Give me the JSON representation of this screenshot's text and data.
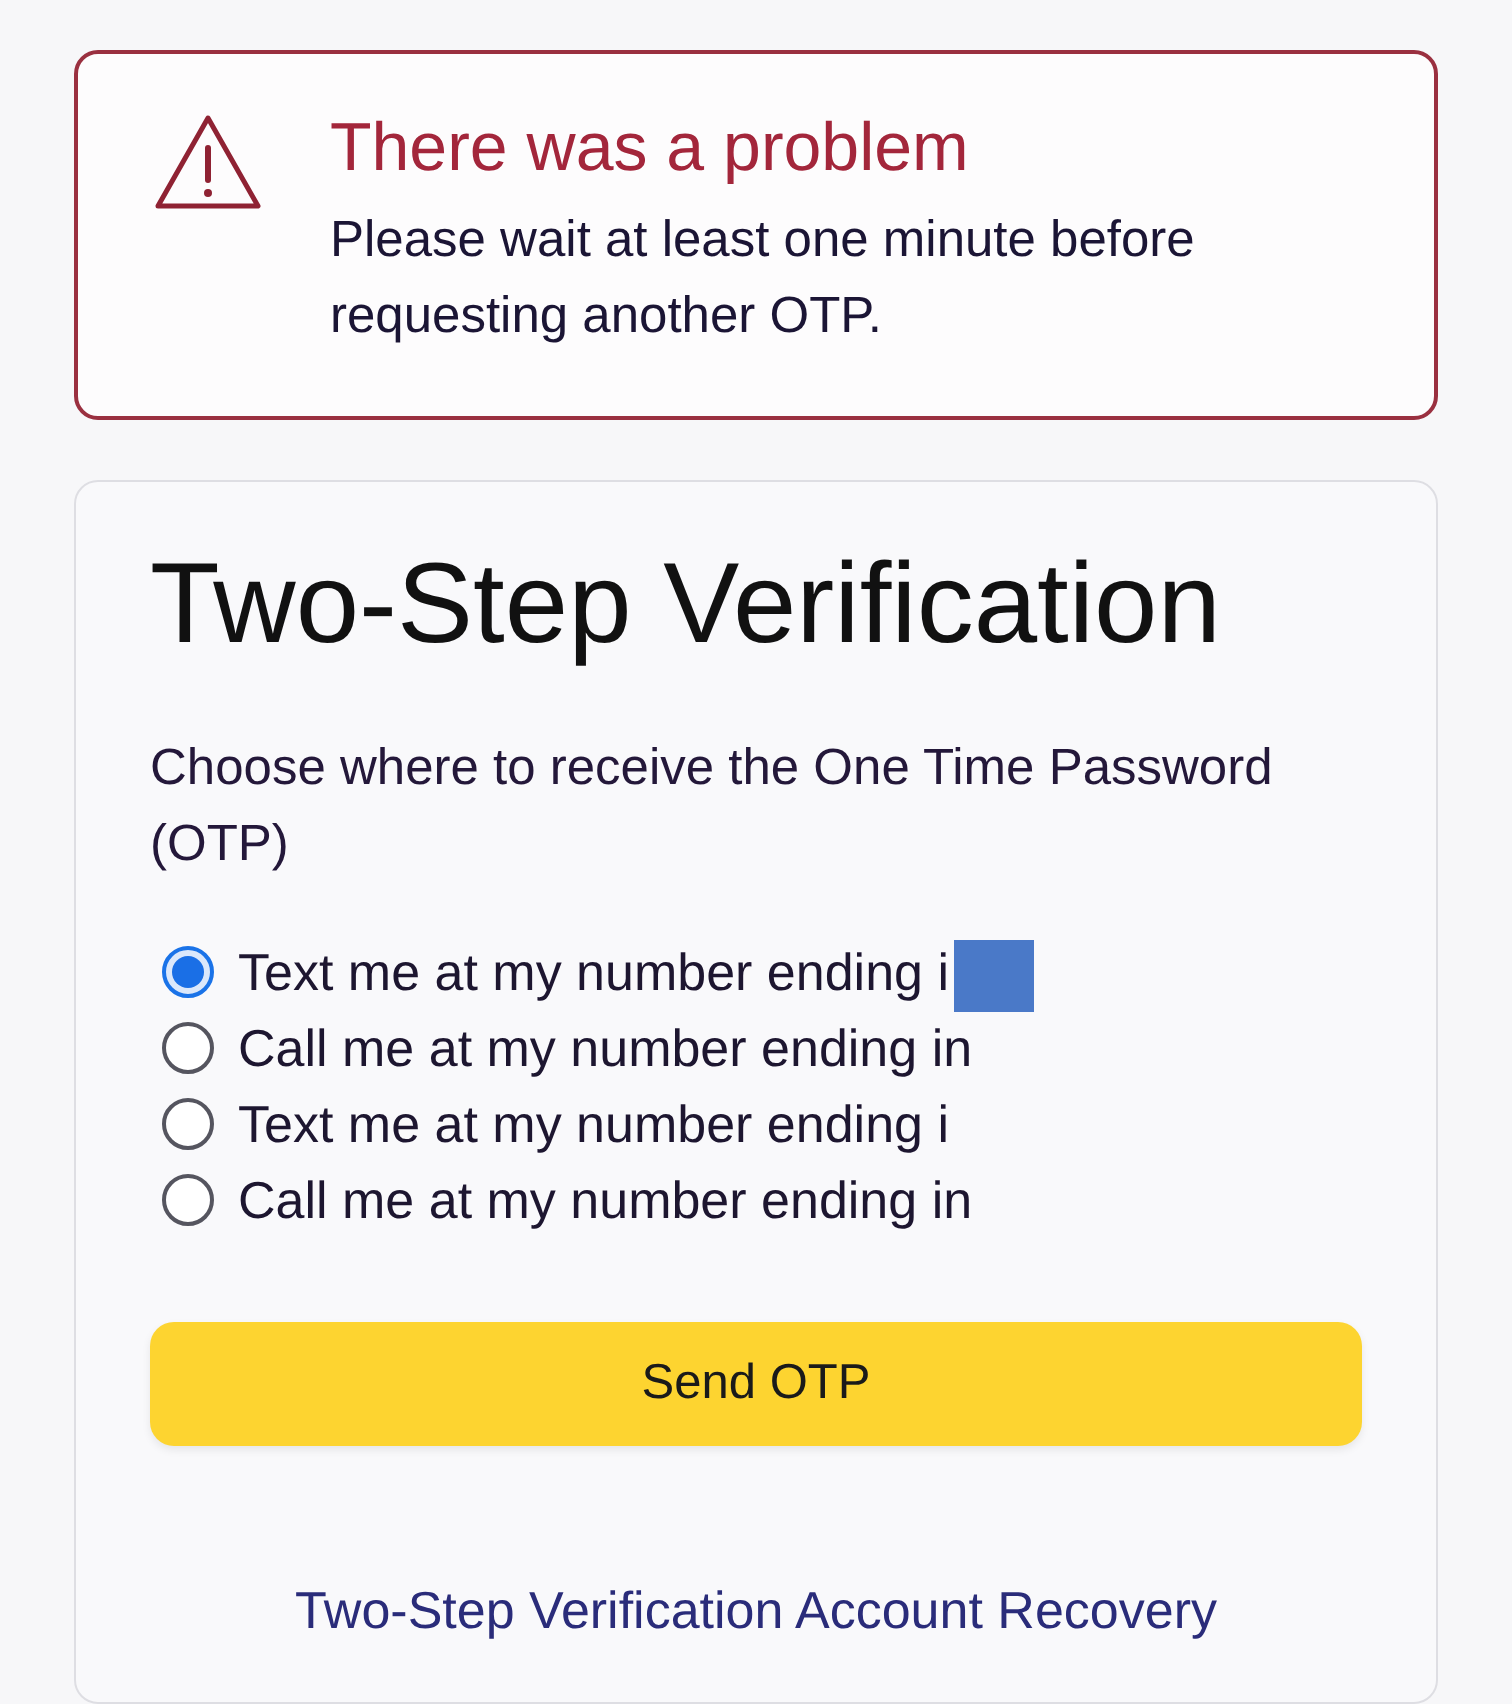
{
  "alert": {
    "title": "There was a problem",
    "message": "Please wait at least one minute before requesting another OTP."
  },
  "card": {
    "title": "Two-Step Verification",
    "prompt": "Choose where to receive the One Time Password (OTP)",
    "options": [
      {
        "label": "Text me at my number ending i",
        "selected": true,
        "redacted": true
      },
      {
        "label": "Call me at my number ending in",
        "selected": false,
        "redacted": false
      },
      {
        "label": "Text me at my number ending i",
        "selected": false,
        "redacted": false
      },
      {
        "label": "Call me at my number ending in",
        "selected": false,
        "redacted": false
      }
    ],
    "button": "Send OTP",
    "link": "Two-Step Verification Account Recovery"
  }
}
